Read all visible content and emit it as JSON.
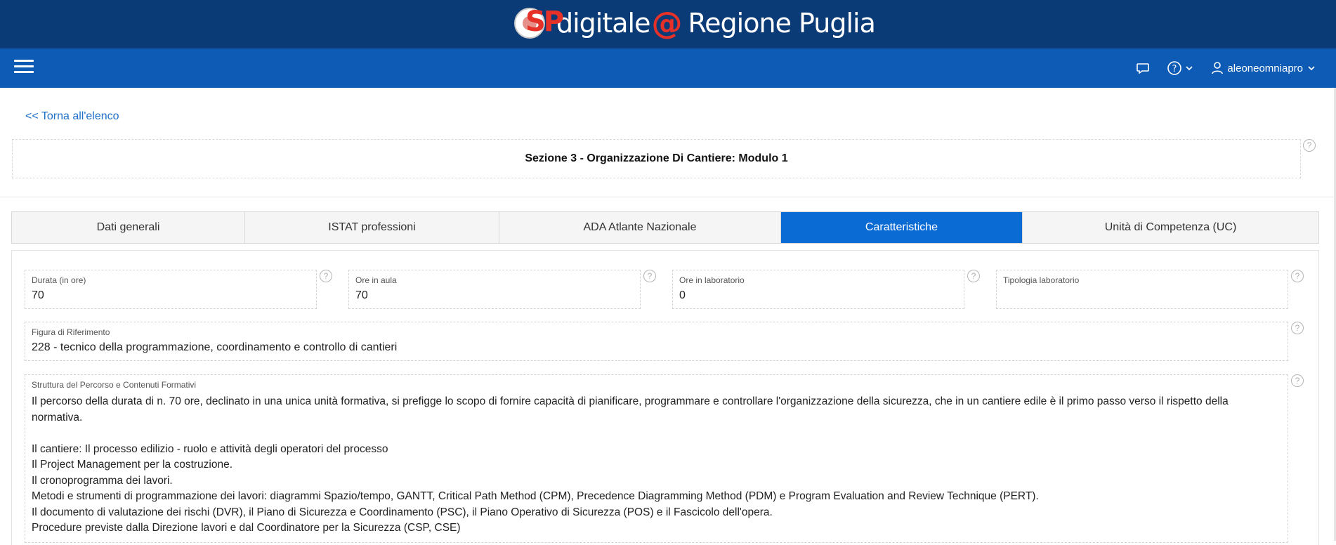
{
  "header": {
    "logo_letters": "SP",
    "brand_left": "digitale",
    "brand_at": "@",
    "brand_right": "Regione Puglia"
  },
  "navbar": {
    "menu_icon": "hamburger-icon",
    "chat_icon": "chat-bubble-icon",
    "help_icon": "question-circle-icon",
    "user_icon": "user-icon",
    "username": "aleoneomniapro"
  },
  "back_link": "<< Torna all'elenco",
  "section_title": "Sezione 3 - Organizzazione Di Cantiere: Modulo 1",
  "help_glyph": "?",
  "tabs": [
    {
      "label": "Dati generali",
      "active": false
    },
    {
      "label": "ISTAT professioni",
      "active": false
    },
    {
      "label": "ADA Atlante Nazionale",
      "active": false
    },
    {
      "label": "Caratteristiche",
      "active": true
    },
    {
      "label": "Unità di Competenza (UC)",
      "active": false
    }
  ],
  "fields": {
    "durata": {
      "label": "Durata (in ore)",
      "value": "70"
    },
    "ore_aula": {
      "label": "Ore in aula",
      "value": "70"
    },
    "ore_lab": {
      "label": "Ore in laboratorio",
      "value": "0"
    },
    "tipologia_lab": {
      "label": "Tipologia laboratorio",
      "value": ""
    },
    "figura": {
      "label": "Figura di Riferimento",
      "value": "228 - tecnico della programmazione, coordinamento e controllo di cantieri"
    },
    "struttura": {
      "label": "Struttura del Percorso e Contenuti Formativi",
      "lines": [
        "Il percorso della durata di n. 70 ore, declinato in una unica unità formativa, si prefigge lo scopo di fornire capacità di pianificare, programmare e controllare l'organizzazione della sicurezza, che in un cantiere edile è il primo passo verso il rispetto della",
        "normativa.",
        "",
        "Il cantiere: Il processo edilizio - ruolo e attività degli operatori del processo",
        "Il Project Management per la costruzione.",
        "Il cronoprogramma dei lavori.",
        "Metodi e strumenti di programmazione dei lavori: diagrammi Spazio/tempo, GANTT, Critical Path Method (CPM), Precedence Diagramming Method (PDM) e Program Evaluation and Review Technique (PERT).",
        "Il documento di valutazione dei rischi (DVR), il Piano di Sicurezza e Coordinamento (PSC), il Piano Operativo di Sicurezza (POS) e il Fascicolo dell'opera.",
        "Procedure previste dalla Direzione lavori e dal Coordinatore per la Sicurezza (CSP, CSE)"
      ]
    }
  }
}
